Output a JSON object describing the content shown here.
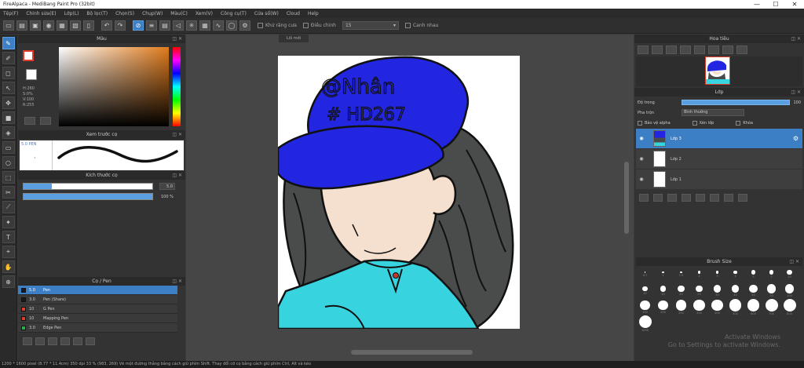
{
  "app": {
    "title": "FireAlpaca - MediBang Paint Pro (32bit)",
    "window_controls": [
      "—",
      "☐",
      "✕"
    ]
  },
  "menu": [
    "Tệp(F)",
    "Chỉnh sửa(E)",
    "Lớp(L)",
    "Bộ lọc(T)",
    "Chọn(S)",
    "Chụp(W)",
    "Màu(C)",
    "Xem(V)",
    "Công cụ(T)",
    "Cửa sổ(W)",
    "Cloud",
    "Help"
  ],
  "toolbar": {
    "antialias_label": "Khử răng cưa",
    "correction_label": "Điều chỉnh",
    "correction_value": "15",
    "canh_nhau_label": "Canh nhau"
  },
  "tools": [
    "✎",
    "✐",
    "◻",
    "↖",
    "✥",
    "■",
    "◈",
    "▭",
    "○",
    "⬚",
    "✂",
    "⟋",
    "✦",
    "T",
    "⌖",
    "✋",
    "⊕"
  ],
  "panels": {
    "color": {
      "title": "Màu",
      "hsv": [
        "H:260",
        "S:0%",
        "V:100",
        "R:255"
      ]
    },
    "brush_preview": {
      "title": "Xem trước cọ",
      "info": "5.0 PEN"
    },
    "brush_size": {
      "title": "Kích thước cọ",
      "size_value": "5.0",
      "opacity_value": "100 %"
    },
    "brushes": {
      "title": "Cọ / Pen",
      "items": [
        {
          "color": "#1a1a1a",
          "size": "5.0",
          "name": "Pen",
          "selected": true
        },
        {
          "color": "#1a1a1a",
          "size": "3.0",
          "name": "Pen (Share)",
          "selected": false
        },
        {
          "color": "#e03c2a",
          "size": "10",
          "name": "G Pen",
          "selected": false
        },
        {
          "color": "#e03c2a",
          "size": "10",
          "name": "Mapping Pen",
          "selected": false
        },
        {
          "color": "#28b04a",
          "size": "3.0",
          "name": "Edge Pen",
          "selected": false
        }
      ]
    },
    "navigator": {
      "title": "Hoa tiêu"
    },
    "layer": {
      "title": "Lớp",
      "opacity_label": "Độ trong",
      "opacity_value": "100",
      "blend_label": "Pha trộn",
      "blend_value": "Bình thường",
      "checks": [
        "Bảo vệ alpha",
        "Xén lớp",
        "Khóa"
      ],
      "layers": [
        {
          "name": "Lớp 3",
          "selected": true
        },
        {
          "name": "Lớp 2",
          "selected": false
        },
        {
          "name": "Lớp 1",
          "selected": false
        }
      ]
    },
    "brush_size_grid": {
      "title": "Brush Size",
      "sizes": [
        "0.7",
        "1",
        "1.5",
        "2",
        "3",
        "4",
        "5",
        "7",
        "10",
        "12",
        "15",
        "20",
        "25",
        "30",
        "40",
        "50",
        "70",
        "100",
        "150",
        "200",
        "250",
        "300",
        "400",
        "500",
        "600",
        "700",
        "800",
        "1000"
      ]
    }
  },
  "canvas": {
    "doc_tab": "Lối mới",
    "art_text": [
      "@Nhân",
      "# HD267"
    ]
  },
  "watermark": {
    "line1": "Activate Windows",
    "line2": "Go to Settings to activate Windows."
  },
  "status": "1200 * 1600 pixel (8.77 * 11.4cm) 350 dpi 33 % (983, 269) Vẽ một đường thẳng bằng cách giữ phím Shift. Thay đổi cỡ cọ bằng cách giữ phím Ctrl, Alt và kéo"
}
